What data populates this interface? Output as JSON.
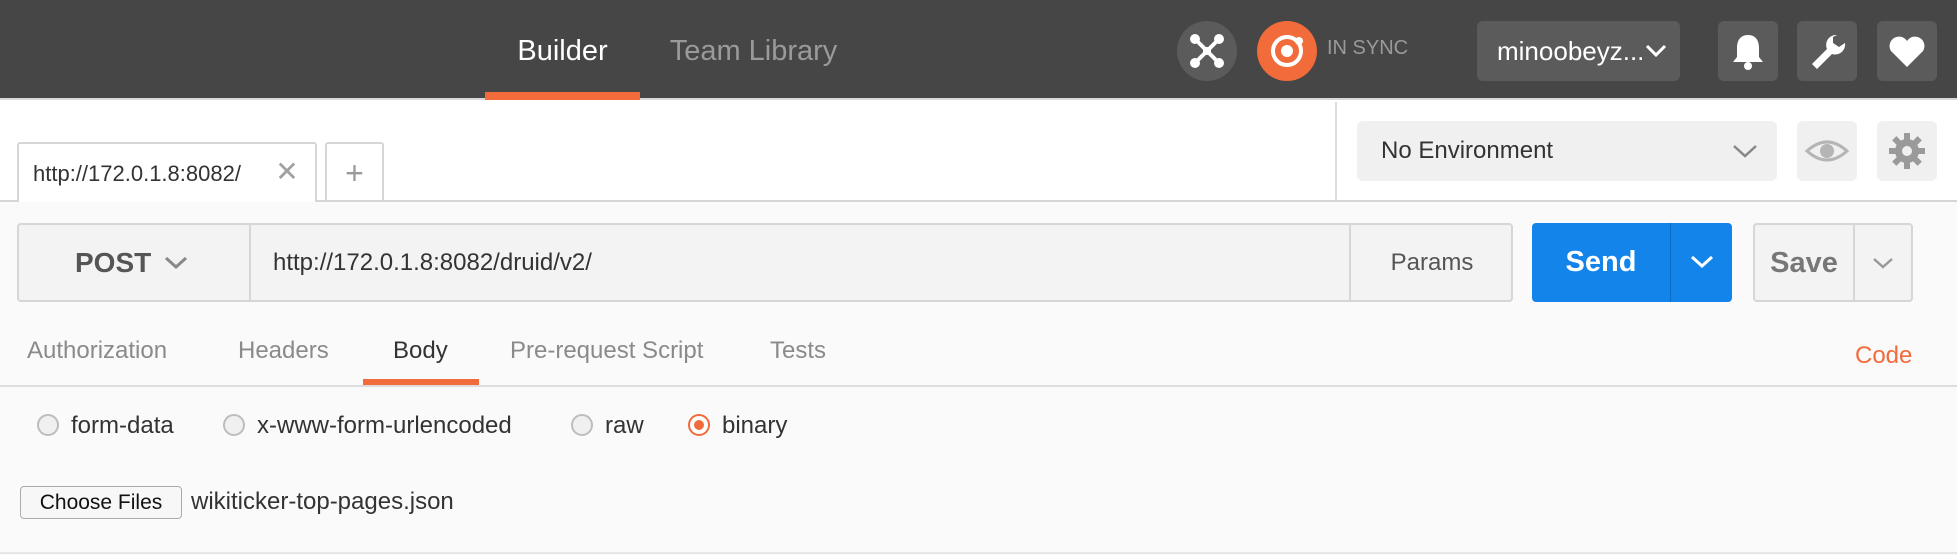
{
  "header": {
    "tabs": [
      {
        "label": "Builder",
        "active": true
      },
      {
        "label": "Team Library",
        "active": false
      }
    ],
    "sync_status": "IN SYNC",
    "user": "minoobeyz...",
    "icons": [
      "interceptor-icon",
      "sync-icon",
      "chevron-down-icon",
      "bell-icon",
      "wrench-icon",
      "heart-icon"
    ]
  },
  "request_tabs": {
    "active_tab_label": "http://172.0.1.8:8082/",
    "new_tab_label": "+",
    "close_glyph": "✕"
  },
  "environment": {
    "selected": "No Environment"
  },
  "request": {
    "method": "POST",
    "url": "http://172.0.1.8:8082/druid/v2/",
    "params_label": "Params",
    "send_label": "Send",
    "save_label": "Save"
  },
  "subtabs": {
    "items": [
      "Authorization",
      "Headers",
      "Body",
      "Pre-request Script",
      "Tests"
    ],
    "active": "Body",
    "code_link": "Code"
  },
  "body": {
    "modes": [
      "form-data",
      "x-www-form-urlencoded",
      "raw",
      "binary"
    ],
    "selected_mode": "binary",
    "choose_files_label": "Choose Files",
    "file_name": "wikiticker-top-pages.json"
  },
  "colors": {
    "accent": "#f26b3a",
    "primary_button": "#1385ea",
    "topbar": "#464646"
  }
}
